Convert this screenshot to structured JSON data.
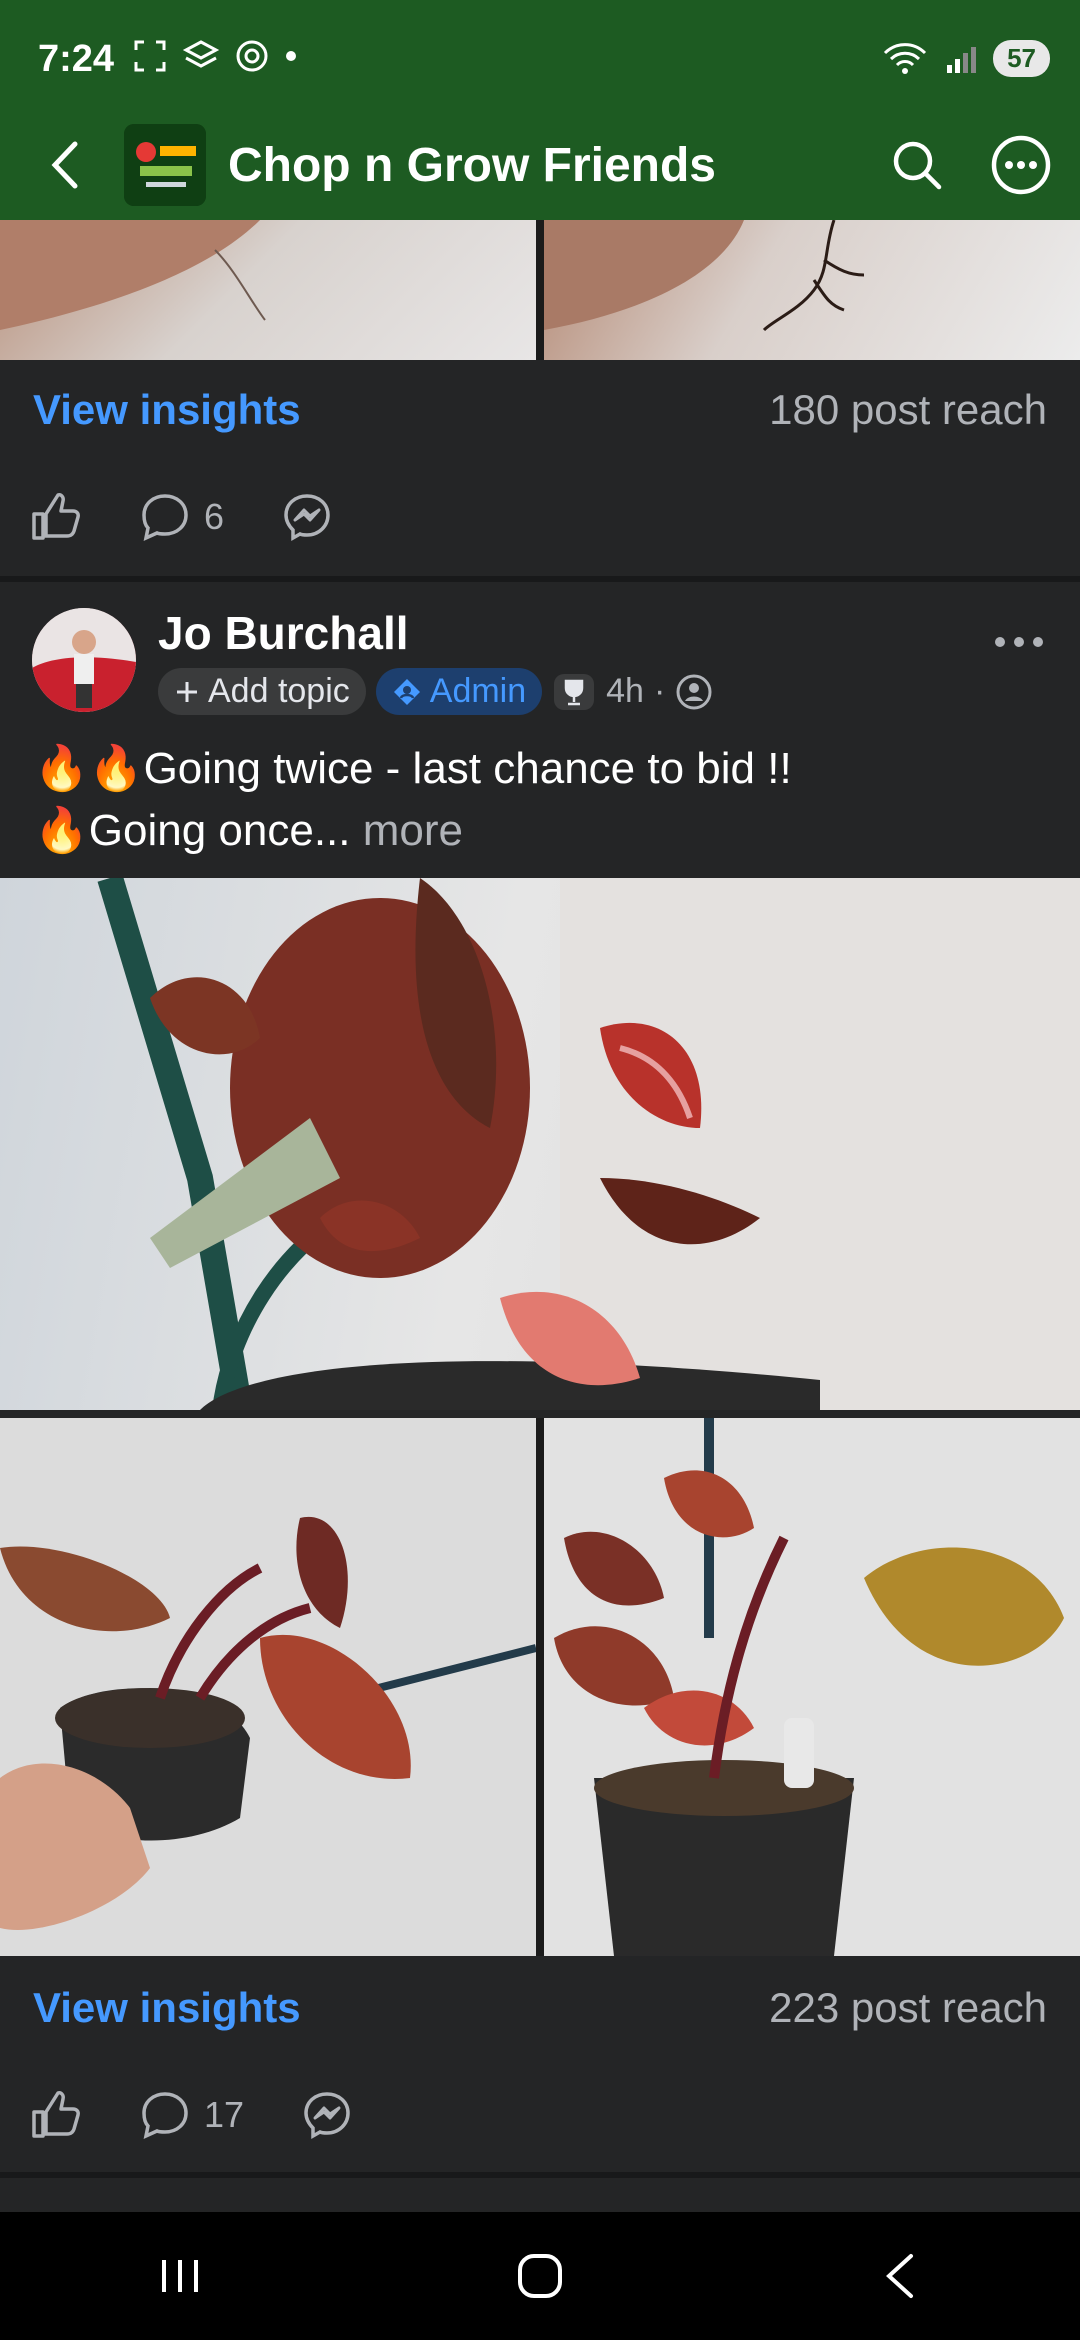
{
  "status_bar": {
    "time": "7:24",
    "battery": "57"
  },
  "header": {
    "group_name": "Chop n Grow Friends"
  },
  "prev_post": {
    "insights_label": "View insights",
    "reach": "180 post reach",
    "comment_count": "6"
  },
  "post": {
    "author": "Jo Burchall",
    "add_topic": "Add topic",
    "role_badge": "Admin",
    "time_ago": "4h",
    "text_line1": "🔥🔥Going twice - last chance to bid !!",
    "text_line2": "🔥Going once...",
    "more_label": "more",
    "insights_label": "View insights",
    "reach": "223 post reach",
    "comment_count": "17"
  },
  "colors": {
    "header_bg": "#1d5b22",
    "feed_bg": "#242526",
    "link_blue": "#4599ff"
  }
}
